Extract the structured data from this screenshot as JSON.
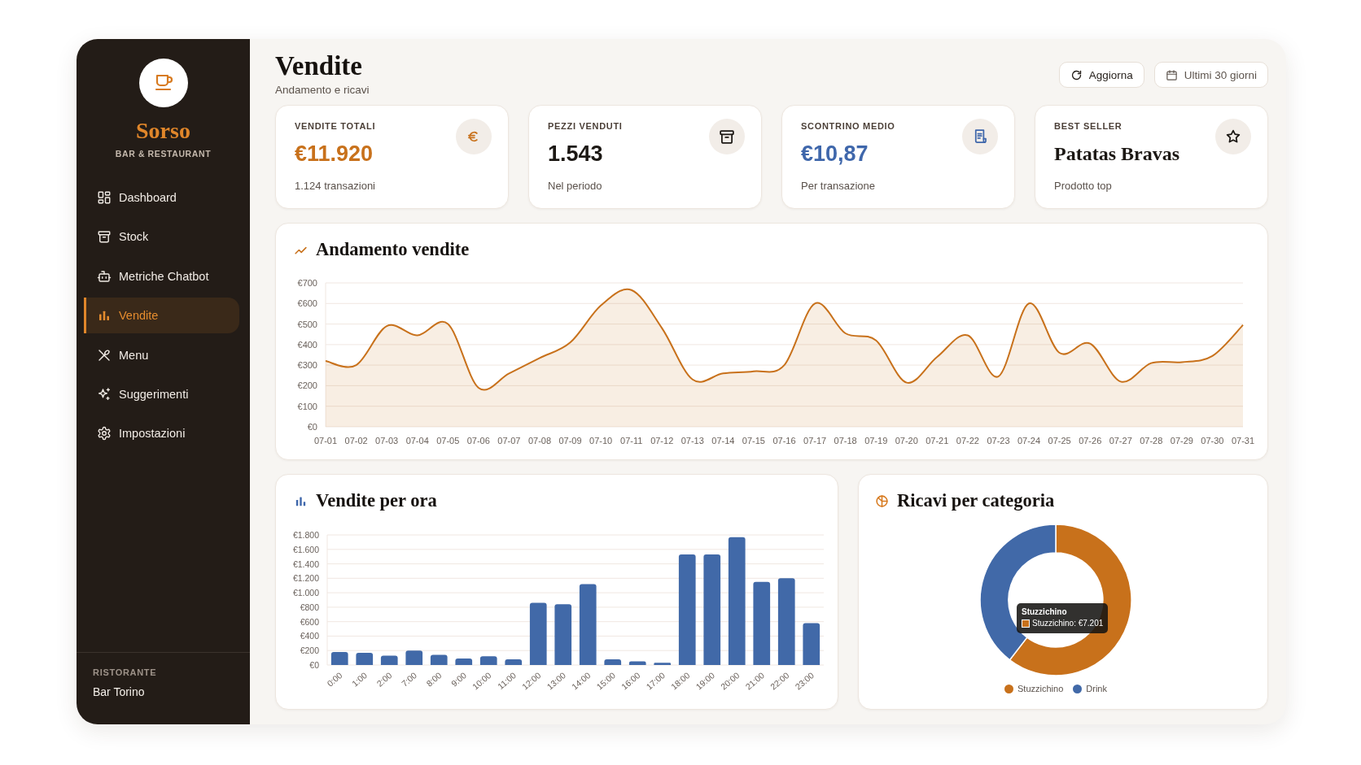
{
  "sidebar": {
    "brand": {
      "name": "Sorso",
      "tagline": "BAR & RESTAURANT"
    },
    "nav": [
      {
        "label": "Dashboard",
        "selected": false
      },
      {
        "label": "Stock",
        "selected": false
      },
      {
        "label": "Metriche Chatbot",
        "selected": false
      },
      {
        "label": "Vendite",
        "selected": true
      },
      {
        "label": "Menu",
        "selected": false
      },
      {
        "label": "Suggerimenti",
        "selected": false
      },
      {
        "label": "Impostazioni",
        "selected": false
      }
    ],
    "footer": {
      "label": "RISTORANTE",
      "value": "Bar Torino"
    }
  },
  "header": {
    "title": "Vendite",
    "subtitle": "Andamento e ricavi",
    "buttons": [
      {
        "label": "Aggiorna",
        "kind": "action"
      },
      {
        "label": "Ultimi 30 giorni",
        "kind": "range"
      }
    ]
  },
  "kpis": [
    {
      "label": "VENDITE TOTALI",
      "value": "€11.920",
      "note": "1.124 transazioni",
      "kind": "amount",
      "color": "#c8711b"
    },
    {
      "label": "PEZZI VENDUTI",
      "value": "1.543",
      "note": "Nel periodo",
      "kind": "amount",
      "color": "#1c1814"
    },
    {
      "label": "SCONTRINO MEDIO",
      "value": "€10,87",
      "note": "Per transazione",
      "kind": "amount",
      "color": "#3f67ab"
    },
    {
      "label": "BEST SELLER",
      "value": "Patatas Bravas",
      "note": "Prodotto top",
      "kind": "product",
      "color": "#1c1814"
    }
  ],
  "sales_trend": {
    "chart_data": {
      "type": "area",
      "title": "Andamento vendite",
      "categories": [
        "07-01",
        "07-02",
        "07-03",
        "07-04",
        "07-05",
        "07-06",
        "07-07",
        "07-08",
        "07-09",
        "07-10",
        "07-11",
        "07-12",
        "07-13",
        "07-14",
        "07-15",
        "07-16",
        "07-17",
        "07-18",
        "07-19",
        "07-20",
        "07-21",
        "07-22",
        "07-23",
        "07-24",
        "07-25",
        "07-26",
        "07-27",
        "07-28",
        "07-29",
        "07-30",
        "07-31"
      ],
      "series": [
        {
          "color": "#c8711b",
          "values": [
            320,
            300,
            490,
            445,
            500,
            190,
            260,
            335,
            410,
            590,
            665,
            480,
            230,
            260,
            270,
            300,
            600,
            455,
            420,
            215,
            340,
            445,
            245,
            600,
            360,
            405,
            220,
            310,
            315,
            345,
            495
          ]
        }
      ],
      "ylim": [
        0,
        700
      ],
      "yticks": [
        {
          "value": 0,
          "label": "€0"
        },
        {
          "value": 100,
          "label": "€100"
        },
        {
          "value": 200,
          "label": "€200"
        },
        {
          "value": 300,
          "label": "€300"
        },
        {
          "value": 400,
          "label": "€400"
        },
        {
          "value": 500,
          "label": "€500"
        },
        {
          "value": 600,
          "label": "€600"
        },
        {
          "value": 700,
          "label": "€700"
        }
      ],
      "grid": true
    }
  },
  "hourly_sales": {
    "chart_data": {
      "type": "bar",
      "title": "Vendite per ora",
      "categories": [
        "0:00",
        "1:00",
        "2:00",
        "7:00",
        "8:00",
        "9:00",
        "10:00",
        "11:00",
        "12:00",
        "13:00",
        "14:00",
        "15:00",
        "16:00",
        "17:00",
        "18:00",
        "19:00",
        "20:00",
        "21:00",
        "22:00",
        "23:00"
      ],
      "series": [
        {
          "color": "#4169a8",
          "values": [
            180,
            170,
            130,
            200,
            140,
            90,
            120,
            80,
            860,
            840,
            1120,
            80,
            50,
            30,
            1530,
            1530,
            1770,
            1150,
            1200,
            580
          ]
        }
      ],
      "ylim": [
        0,
        1800
      ],
      "yticks": [
        {
          "value": 0,
          "label": "€0"
        },
        {
          "value": 200,
          "label": "€200"
        },
        {
          "value": 400,
          "label": "€400"
        },
        {
          "value": 600,
          "label": "€600"
        },
        {
          "value": 800,
          "label": "€800"
        },
        {
          "value": 1000,
          "label": "€1.000"
        },
        {
          "value": 1200,
          "label": "€1.200"
        },
        {
          "value": 1400,
          "label": "€1.400"
        },
        {
          "value": 1600,
          "label": "€1.600"
        },
        {
          "value": 1800,
          "label": "€1.800"
        }
      ],
      "grid": true
    }
  },
  "category_revenue": {
    "chart_data": {
      "type": "donut",
      "title": "Ricavi per categoria",
      "categories": [
        "Stuzzichino",
        "Drink"
      ],
      "values": [
        60.4,
        39.6
      ]
    },
    "legend": [
      {
        "color": "#c8711b"
      },
      {
        "color": "#4169a8"
      }
    ],
    "tooltip": {
      "title": "Stuzzichino",
      "text": "Stuzzichino: €7.201",
      "color": "#c8711b"
    }
  }
}
